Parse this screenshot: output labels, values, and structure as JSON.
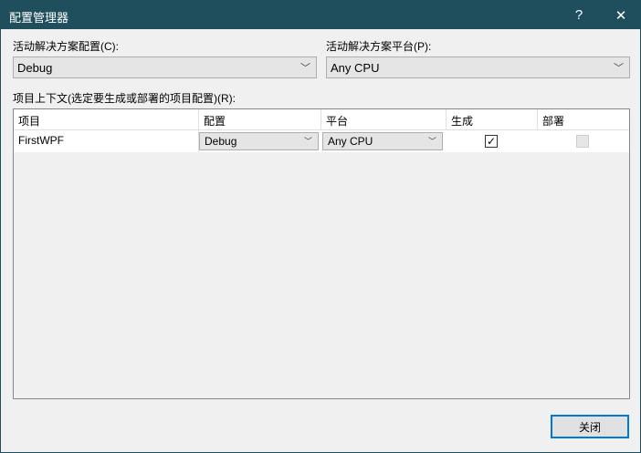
{
  "window": {
    "title": "配置管理器",
    "help": "?",
    "close": "✕"
  },
  "active_config": {
    "label": "活动解决方案配置(C):",
    "value": "Debug"
  },
  "active_platform": {
    "label": "活动解决方案平台(P):",
    "value": "Any CPU"
  },
  "context_label": "项目上下文(选定要生成或部署的项目配置)(R):",
  "grid": {
    "headers": [
      "项目",
      "配置",
      "平台",
      "生成",
      "部署"
    ],
    "rows": [
      {
        "project": "FirstWPF",
        "config": "Debug",
        "platform": "Any CPU",
        "build": true,
        "deploy": false
      }
    ]
  },
  "close_button": "关闭"
}
